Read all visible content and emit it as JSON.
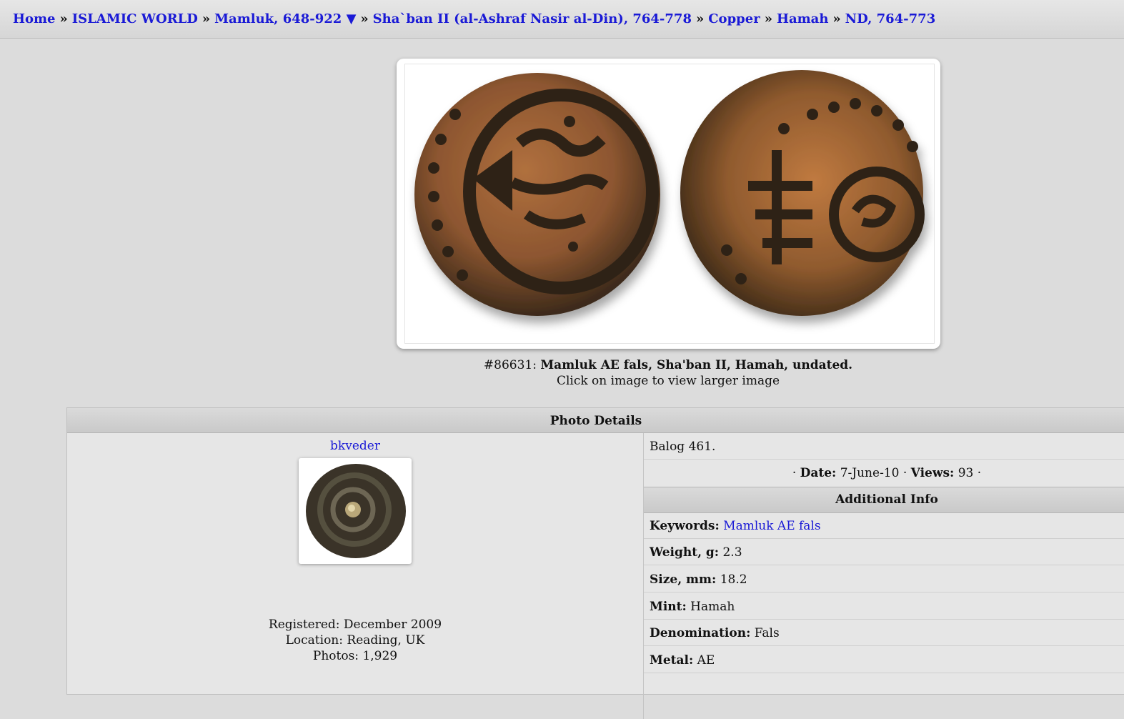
{
  "breadcrumb": {
    "items": [
      {
        "label": "Home"
      },
      {
        "label": "ISLAMIC WORLD"
      },
      {
        "label": "Mamluk, 648-922 ▼"
      },
      {
        "label": "Sha`ban II (al-Ashraf Nasir al-Din), 764-778"
      },
      {
        "label": "Copper"
      },
      {
        "label": "Hamah"
      },
      {
        "label": "ND, 764-773"
      }
    ],
    "separator": "»"
  },
  "photo": {
    "number": "#86631:",
    "title": "Mamluk AE fals, Sha'ban II, Hamah, undated.",
    "hint": "Click on image to view larger image"
  },
  "details": {
    "header": "Photo Details",
    "user": {
      "name": "bkveder",
      "registered": "Registered: December 2009",
      "location": "Location: Reading, UK",
      "photos": "Photos: 1,929"
    },
    "description": "Balog 461.",
    "meta": {
      "date_label": "Date:",
      "date_value": "7-June-10",
      "views_label": "Views:",
      "views_value": "93"
    },
    "additional_header": "Additional Info",
    "keywords_label": "Keywords:",
    "keywords_value": "Mamluk AE fals",
    "fields": [
      {
        "label": "Weight, g:",
        "value": "2.3"
      },
      {
        "label": "Size, mm:",
        "value": "18.2"
      },
      {
        "label": "Mint:",
        "value": "Hamah"
      },
      {
        "label": "Denomination:",
        "value": "Fals"
      },
      {
        "label": "Metal:",
        "value": "AE"
      }
    ]
  },
  "colors": {
    "link": "#1a1ad6",
    "background": "#dcdcdc",
    "coin_dark": "#2e2418",
    "coin_copper": "#a9683a"
  }
}
